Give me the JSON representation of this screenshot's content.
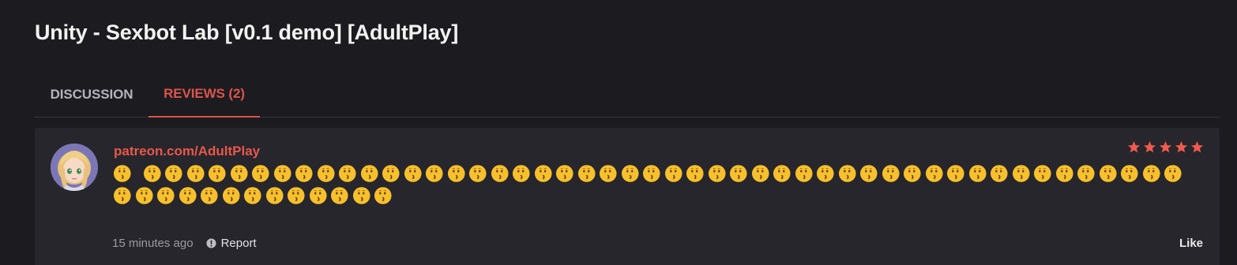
{
  "thread": {
    "title": "Unity - Sexbot Lab [v0.1 demo] [AdultPlay]"
  },
  "tabs": [
    {
      "label": "DISCUSSION"
    },
    {
      "label": "REVIEWS (2)"
    }
  ],
  "review": {
    "author": "patreon.com/AdultPlay",
    "rating": 5,
    "rating_max": 5,
    "emoji": "kissing-face",
    "emoji_count_line1_first": 1,
    "emoji_count_line1_rest": 48,
    "emoji_count_line2": 13,
    "timestamp": "15 minutes ago",
    "report_label": "Report",
    "like_label": "Like"
  },
  "colors": {
    "accent": "#d9554a",
    "star": "#f05a4e",
    "background": "#1c1b20",
    "card": "#27262c"
  }
}
